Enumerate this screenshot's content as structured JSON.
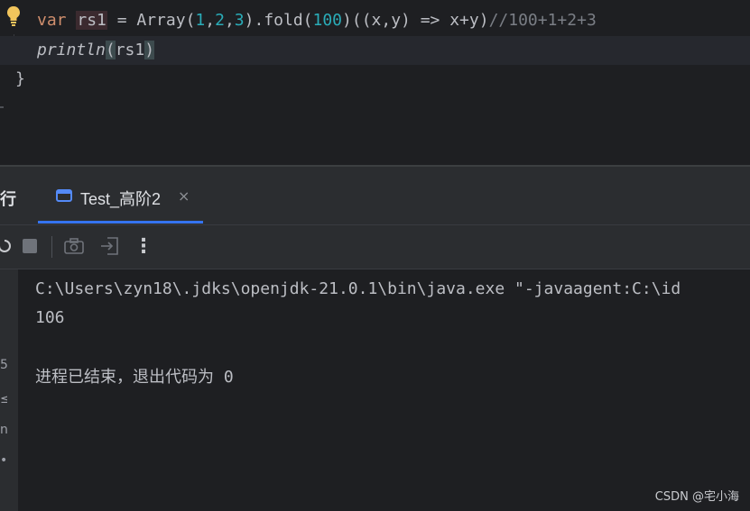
{
  "editor": {
    "line1": {
      "kw_var": "var",
      "var_name": "rs1",
      "eq": " = Array(",
      "n1": "1",
      "comma1": ",",
      "n2": "2",
      "comma2": ",",
      "n3": "3",
      "mid": ").fold(",
      "n100": "100",
      "rest": ")((x,y) => x+y)",
      "comment": "//100+1+2+3"
    },
    "line2": {
      "fn": "println",
      "open_paren": "(",
      "arg": "rs1",
      "close_paren": ")"
    },
    "line3": {
      "brace": "}"
    },
    "bulb_icon": "lightbulb-icon"
  },
  "tool_window": {
    "title": "行",
    "tab": {
      "label": "Test_高阶2",
      "close": "×",
      "icon": "run-config-icon"
    },
    "toolbar": {
      "icons": [
        "rerun-icon",
        "stop-icon",
        "screenshot-icon",
        "exit-icon",
        "more-icon"
      ],
      "more_glyph": "⋮"
    },
    "console": {
      "lines": [
        "C:\\Users\\zyn18\\.jdks\\openjdk-21.0.1\\bin\\java.exe \"-javaagent:C:\\id",
        "106",
        "进程已结束，退出代码为 0"
      ]
    },
    "left_strip_glyphs": [
      "5",
      "≤",
      "n",
      "•"
    ]
  },
  "watermark": "CSDN @宅小海",
  "colors": {
    "editor_bg": "#1e1f22",
    "panel_bg": "#2b2d30",
    "keyword": "#cf8e6d",
    "number": "#2aacb8",
    "comment": "#7a7e85",
    "text": "#bcbec4",
    "accent": "#3574f0"
  }
}
